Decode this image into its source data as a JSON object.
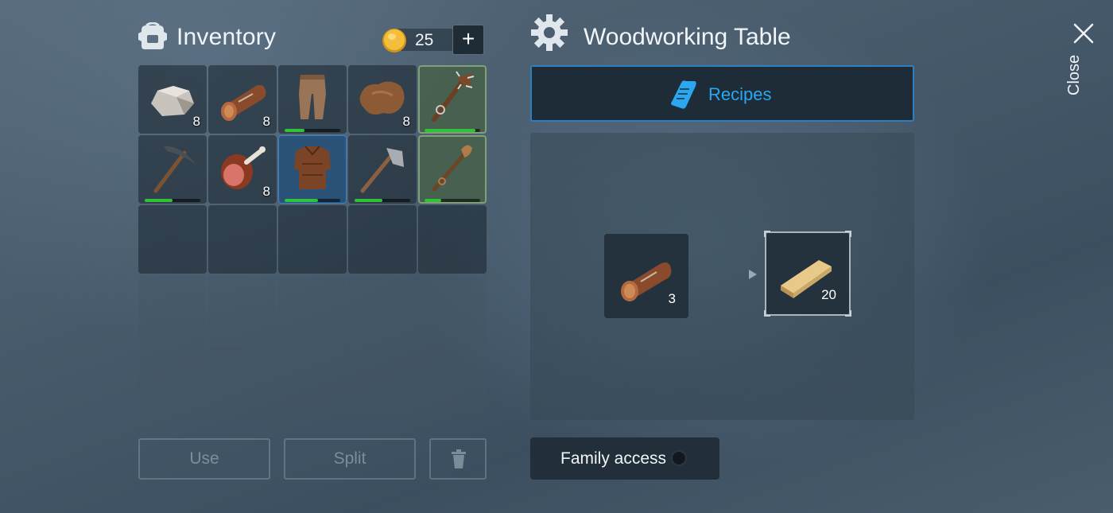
{
  "inventory": {
    "title": "Inventory",
    "coins": "25",
    "add_label": "+",
    "slots": [
      {
        "item": "stone",
        "qty": "8"
      },
      {
        "item": "wood log",
        "qty": "8"
      },
      {
        "item": "leather pants",
        "durability": 0.35
      },
      {
        "item": "animal hide",
        "qty": "8"
      },
      {
        "item": "spiked club",
        "durability": 0.92
      },
      {
        "item": "pickaxe",
        "durability": 0.5
      },
      {
        "item": "ham",
        "qty": "8"
      },
      {
        "item": "leather chest armor",
        "durability": 0.6
      },
      {
        "item": "hatchet",
        "durability": 0.5
      },
      {
        "item": "torch staff",
        "durability": 0.3
      }
    ],
    "buttons": {
      "use": "Use",
      "split": "Split"
    }
  },
  "station": {
    "title": "Woodworking Table",
    "tab_label": "Recipes",
    "recipe": {
      "ingredient": {
        "item": "wood log",
        "qty": "3"
      },
      "result": {
        "item": "wooden plank",
        "qty": "20"
      }
    },
    "family_access_label": "Family access"
  },
  "close_label": "Close",
  "colors": {
    "accent": "#2aa7f0",
    "durability": "#31c23a",
    "equipped": "#7fa079"
  }
}
